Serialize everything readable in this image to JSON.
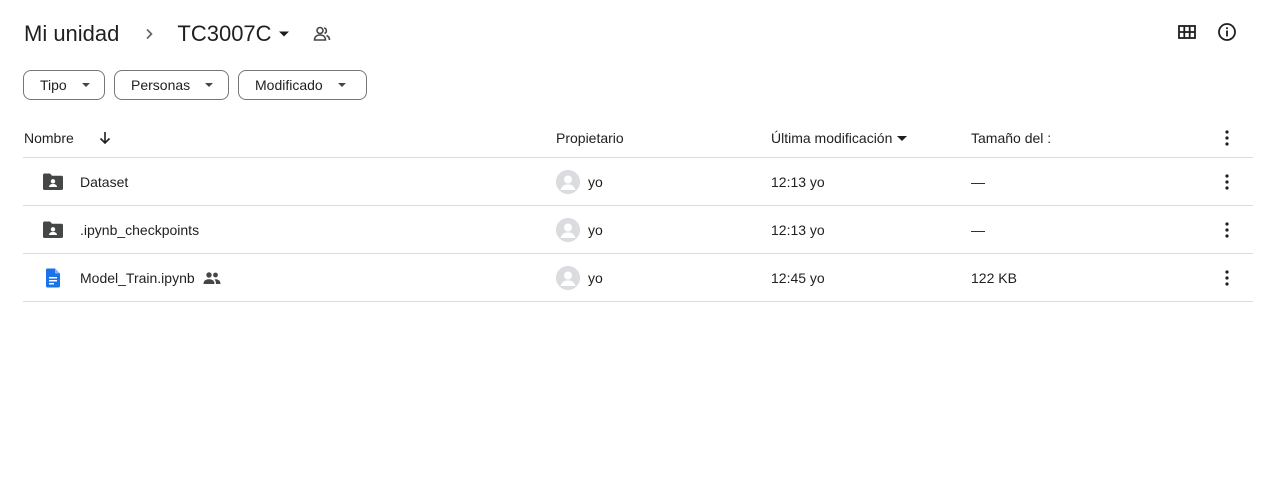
{
  "breadcrumb": {
    "root": "Mi unidad",
    "current": "TC3007C"
  },
  "header_actions": {
    "grid_view_icon": "grid-view-icon",
    "info_icon": "info-icon"
  },
  "filters": [
    {
      "label": "Tipo"
    },
    {
      "label": "Personas"
    },
    {
      "label": "Modificado"
    }
  ],
  "table": {
    "columns": {
      "name": "Nombre",
      "owner": "Propietario",
      "modified": "Última modificación",
      "size": "Tamaño del :"
    },
    "rows": [
      {
        "name": "Dataset",
        "type": "shared-folder",
        "owner": "yo",
        "modified": "12:13 yo",
        "size": "—",
        "shared": false
      },
      {
        "name": ".ipynb_checkpoints",
        "type": "shared-folder",
        "owner": "yo",
        "modified": "12:13 yo",
        "size": "—",
        "shared": false
      },
      {
        "name": "Model_Train.ipynb",
        "type": "document",
        "owner": "yo",
        "modified": "12:45 yo",
        "size": "122 KB",
        "shared": true
      }
    ]
  },
  "colors": {
    "text": "#1f1f1f",
    "folder_icon": "#444746",
    "doc_icon": "#1a73e8",
    "divider": "#dadce0",
    "chip_border": "#747775"
  }
}
